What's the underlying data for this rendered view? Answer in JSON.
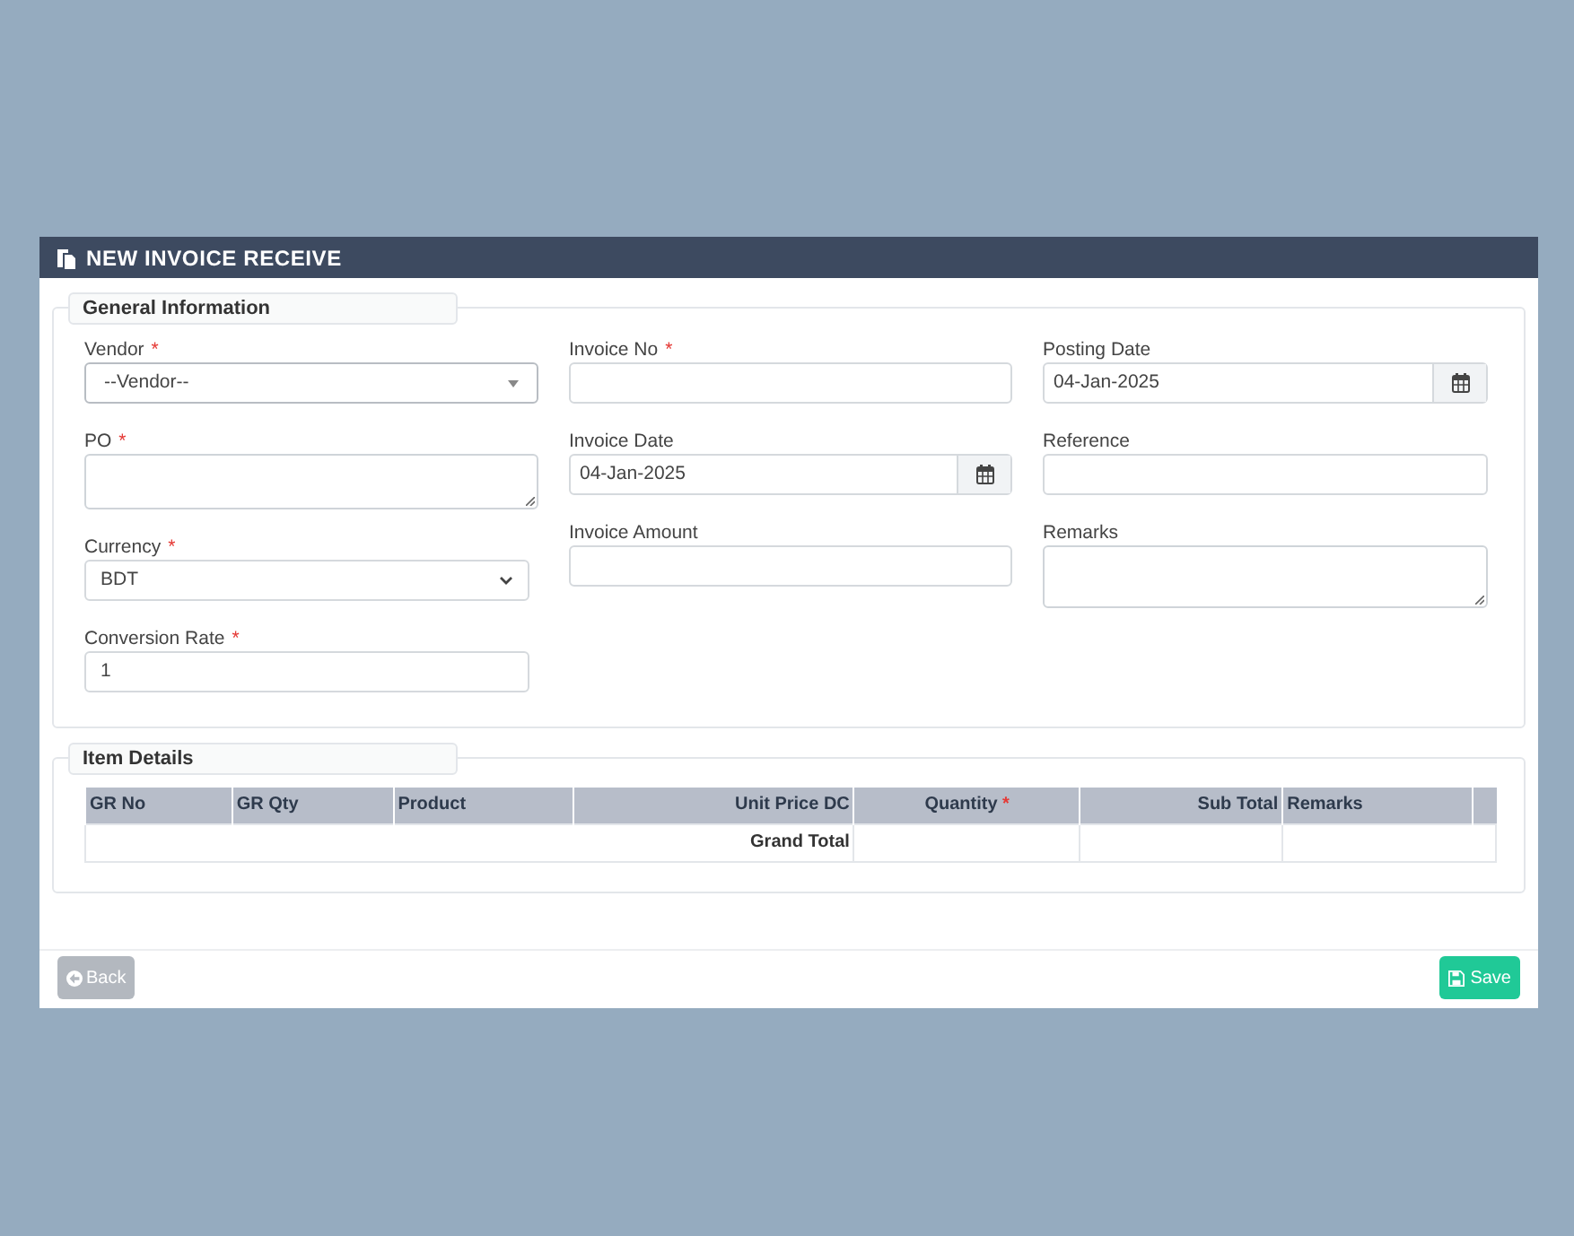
{
  "window": {
    "title": "NEW INVOICE RECEIVE"
  },
  "general_information": {
    "legend": "General Information",
    "columns": [
      [
        {
          "kind": "select",
          "label": "Vendor",
          "required_mark": "*",
          "value": "--Vendor--"
        },
        {
          "kind": "textarea",
          "label": "PO",
          "required_mark": "*"
        },
        {
          "kind": "dropdown",
          "label": "Currency",
          "required_mark": "*",
          "value": "BDT"
        },
        {
          "kind": "input",
          "label": "Conversion Rate",
          "required_mark": "*",
          "value": "1"
        }
      ],
      [
        {
          "kind": "input",
          "label": "Invoice No",
          "required_mark": "*"
        },
        {
          "kind": "date",
          "label": "Invoice Date",
          "value": "04-Jan-2025"
        },
        {
          "kind": "input",
          "label": "Invoice Amount"
        }
      ],
      [
        {
          "kind": "date",
          "label": "Posting Date",
          "value": "04-Jan-2025"
        },
        {
          "kind": "input",
          "label": "Reference"
        },
        {
          "kind": "textarea",
          "label": "Remarks"
        }
      ]
    ]
  },
  "item_details": {
    "legend": "Item Details",
    "table": {
      "columns": [
        {
          "label": "GR No"
        },
        {
          "label": "GR Qty"
        },
        {
          "label": "Product"
        },
        {
          "label": "Unit Price DC"
        },
        {
          "label": "Quantity",
          "required_mark": "*"
        },
        {
          "label": "Sub Total"
        },
        {
          "label": "Remarks"
        }
      ],
      "footer": {
        "label": "Grand Total"
      }
    }
  },
  "buttons": [
    {
      "kind": "back",
      "label": "Back"
    },
    {
      "kind": "save",
      "label": "Save"
    }
  ]
}
